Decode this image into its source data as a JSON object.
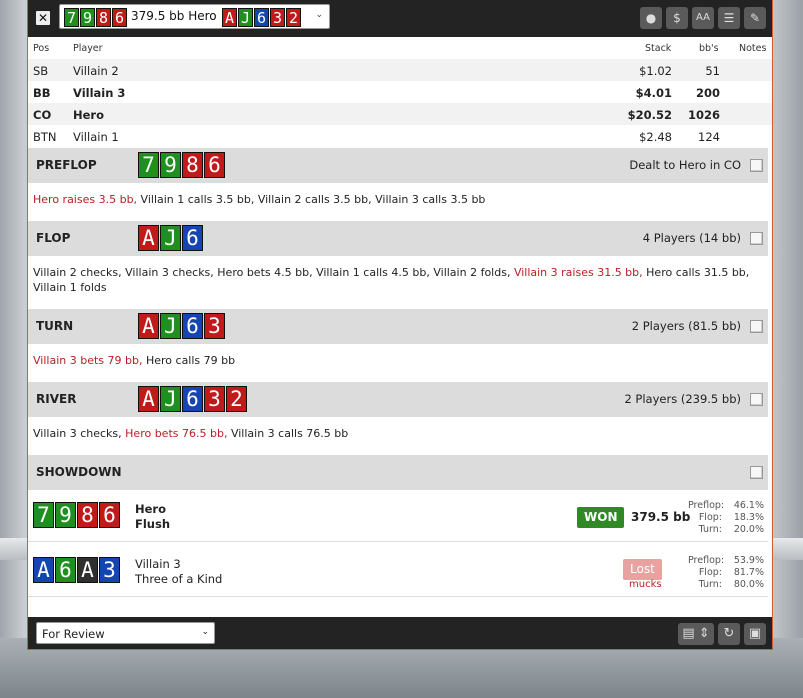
{
  "header": {
    "close_label": "✕",
    "hand_select_text": "379.5 bb Hero",
    "hero_cards": [
      {
        "r": "7",
        "s": "c"
      },
      {
        "r": "9",
        "s": "c"
      },
      {
        "r": "8",
        "s": "h"
      },
      {
        "r": "6",
        "s": "h"
      }
    ],
    "board_cards": [
      {
        "r": "A",
        "s": "h"
      },
      {
        "r": "J",
        "s": "c"
      },
      {
        "r": "6",
        "s": "d"
      },
      {
        "r": "3",
        "s": "h"
      },
      {
        "r": "2",
        "s": "h"
      }
    ],
    "tools": [
      "person-icon",
      "dollar-icon",
      "font-size-icon",
      "list-icon",
      "pencil-icon"
    ]
  },
  "players": {
    "headers": {
      "pos": "Pos",
      "player": "Player",
      "stack": "Stack",
      "bbs": "bb's",
      "notes": "Notes"
    },
    "rows": [
      {
        "pos": "SB",
        "name": "Villain 2",
        "stack": "$1.02",
        "bbs": "51",
        "bold": false
      },
      {
        "pos": "BB",
        "name": "Villain 3",
        "stack": "$4.01",
        "bbs": "200",
        "bold": true
      },
      {
        "pos": "CO",
        "name": "Hero",
        "stack": "$20.52",
        "bbs": "1026",
        "bold": true
      },
      {
        "pos": "BTN",
        "name": "Villain 1",
        "stack": "$2.48",
        "bbs": "124",
        "bold": false
      }
    ]
  },
  "streets": {
    "preflop": {
      "label": "PREFLOP",
      "info": "Dealt to Hero in CO",
      "cards": [
        {
          "r": "7",
          "s": "c"
        },
        {
          "r": "9",
          "s": "c"
        },
        {
          "r": "8",
          "s": "h"
        },
        {
          "r": "6",
          "s": "h"
        }
      ],
      "actions": [
        {
          "t": "Hero raises 3.5 bb, ",
          "red": true
        },
        {
          "t": "Villain 1 calls 3.5 bb, Villain 2 calls 3.5 bb, Villain 3 calls 3.5 bb",
          "red": false
        }
      ]
    },
    "flop": {
      "label": "FLOP",
      "info": "4 Players (14 bb)",
      "cards": [
        {
          "r": "A",
          "s": "h"
        },
        {
          "r": "J",
          "s": "c"
        },
        {
          "r": "6",
          "s": "d"
        }
      ],
      "actions": [
        {
          "t": "Villain 2 checks, Villain 3 checks, Hero bets 4.5 bb, Villain 1 calls 4.5 bb, Villain 2 folds, ",
          "red": false
        },
        {
          "t": "Villain 3 raises 31.5 bb, ",
          "red": true
        },
        {
          "t": "Hero calls 31.5 bb, Villain 1 folds",
          "red": false
        }
      ]
    },
    "turn": {
      "label": "TURN",
      "info": "2 Players (81.5 bb)",
      "cards": [
        {
          "r": "A",
          "s": "h"
        },
        {
          "r": "J",
          "s": "c"
        },
        {
          "r": "6",
          "s": "d"
        },
        {
          "r": "3",
          "s": "h"
        }
      ],
      "actions": [
        {
          "t": "Villain 3 bets 79 bb, ",
          "red": true
        },
        {
          "t": "Hero calls 79 bb",
          "red": false
        }
      ]
    },
    "river": {
      "label": "RIVER",
      "info": "2 Players (239.5 bb)",
      "cards": [
        {
          "r": "A",
          "s": "h"
        },
        {
          "r": "J",
          "s": "c"
        },
        {
          "r": "6",
          "s": "d"
        },
        {
          "r": "3",
          "s": "h"
        },
        {
          "r": "2",
          "s": "h"
        }
      ],
      "actions": [
        {
          "t": "Villain 3 checks, ",
          "red": false
        },
        {
          "t": "Hero bets 76.5 bb, ",
          "red": true
        },
        {
          "t": "Villain 3 calls 76.5 bb",
          "red": false
        }
      ]
    }
  },
  "showdown": {
    "label": "SHOWDOWN",
    "hero": {
      "name": "Hero",
      "hand": "Flush",
      "result": "WON",
      "amount": "379.5 bb",
      "cards": [
        {
          "r": "7",
          "s": "c"
        },
        {
          "r": "9",
          "s": "c"
        },
        {
          "r": "8",
          "s": "h"
        },
        {
          "r": "6",
          "s": "h"
        }
      ],
      "equity": [
        {
          "k": "Preflop:",
          "v": "46.1%"
        },
        {
          "k": "Flop:",
          "v": "18.3%"
        },
        {
          "k": "Turn:",
          "v": "20.0%"
        }
      ]
    },
    "villain": {
      "name": "Villain 3",
      "hand": "Three of a Kind",
      "result": "Lost",
      "note": "mucks",
      "cards": [
        {
          "r": "A",
          "s": "d"
        },
        {
          "r": "6",
          "s": "c"
        },
        {
          "r": "A",
          "s": "s"
        },
        {
          "r": "3",
          "s": "d"
        }
      ],
      "equity": [
        {
          "k": "Preflop:",
          "v": "53.9%"
        },
        {
          "k": "Flop:",
          "v": "81.7%"
        },
        {
          "k": "Turn:",
          "v": "80.0%"
        }
      ]
    }
  },
  "footer": {
    "review_select": "For Review",
    "tools": [
      "clipboard-icon",
      "refresh-icon",
      "save-icon"
    ]
  }
}
